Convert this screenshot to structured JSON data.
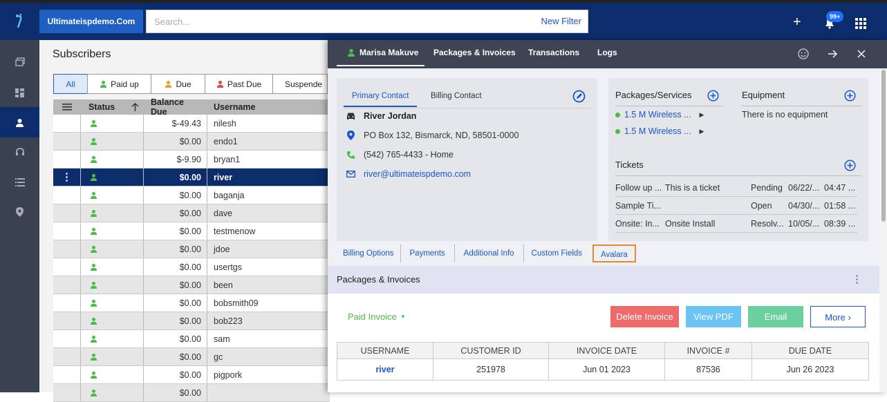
{
  "topbar": {
    "domain": "Ultimateispdemo.Com",
    "search_placeholder": "Search...",
    "new_filter": "New Filter",
    "notif_badge": "99+"
  },
  "sidebar": {
    "icons": [
      "pages-icon",
      "dashboard-icon",
      "user-icon",
      "headset-icon",
      "list-icon",
      "location-icon"
    ],
    "active": 2
  },
  "subscribers": {
    "title": "Subscribers",
    "filters": [
      {
        "label": "All",
        "color": ""
      },
      {
        "label": "Paid up",
        "color": "#4cbb4c"
      },
      {
        "label": "Due",
        "color": "#f0a020"
      },
      {
        "label": "Past Due",
        "color": "#e04848"
      },
      {
        "label": "Suspende",
        "color": "#e04848"
      }
    ],
    "columns": [
      "Status",
      "Balance Due",
      "Username"
    ],
    "rows": [
      {
        "balance": "$-49.43",
        "username": "nilesh"
      },
      {
        "balance": "$0.00",
        "username": "endo1"
      },
      {
        "balance": "$-9.90",
        "username": "bryan1"
      },
      {
        "balance": "$0.00",
        "username": "river"
      },
      {
        "balance": "$0.00",
        "username": "baganja"
      },
      {
        "balance": "$0.00",
        "username": "dave"
      },
      {
        "balance": "$0.00",
        "username": "testmenow"
      },
      {
        "balance": "$0.00",
        "username": "jdoe"
      },
      {
        "balance": "$0.00",
        "username": "usertgs"
      },
      {
        "balance": "$0.00",
        "username": "been"
      },
      {
        "balance": "$0.00",
        "username": "bobsmith09"
      },
      {
        "balance": "$0.00",
        "username": "bob223"
      },
      {
        "balance": "$0.00",
        "username": "sam"
      },
      {
        "balance": "$0.00",
        "username": "gc"
      },
      {
        "balance": "$0.00",
        "username": "pigpork"
      },
      {
        "balance": "$0.00",
        "username": ""
      }
    ]
  },
  "panel": {
    "tabs": [
      "Marisa Makuve",
      "Packages & Invoices",
      "Transactions",
      "Logs"
    ],
    "contact": {
      "tab_primary": "Primary Contact",
      "tab_billing": "Billing Contact",
      "name": "River Jordan",
      "address": "PO Box 132, Bismarck, ND, 58501-0000",
      "phone": "(542) 765-4433 - Home",
      "email": "river@ultimateispdemo.com"
    },
    "packages": {
      "title": "Packages/Services",
      "items": [
        "1.5 M Wireless ...",
        "1.5 M Wireless ..."
      ]
    },
    "equipment": {
      "title": "Equipment",
      "empty": "There is no equipment"
    },
    "tickets": {
      "title": "Tickets",
      "rows": [
        {
          "type": "Follow up ...",
          "subject": "This is a ticket",
          "status": "Pending",
          "date": "06/22/...",
          "time": "04:47 ..."
        },
        {
          "type": "Sample Ti...",
          "subject": "",
          "status": "Open",
          "date": "04/30/...",
          "time": "01:58 ..."
        },
        {
          "type": "Onsite: In...",
          "subject": "Onsite Install",
          "status": "Resolv...",
          "date": "10/05/...",
          "time": "08:39 ..."
        }
      ]
    },
    "bottom_tabs": [
      "Billing Options",
      "Payments",
      "Additional Info",
      "Custom Fields",
      "Avalara"
    ],
    "pi": {
      "title": "Packages & Invoices",
      "status": "Paid Invoice",
      "buttons": {
        "delete": "Delete Invoice",
        "pdf": "View PDF",
        "email": "Email",
        "more": "More"
      },
      "colors": {
        "delete": "#ef6b6b",
        "pdf": "#6cc4f2",
        "email": "#6ccf9e"
      },
      "columns": [
        "USERNAME",
        "CUSTOMER ID",
        "INVOICE DATE",
        "INVOICE #",
        "DUE DATE"
      ],
      "row": [
        "river",
        "251978",
        "Jun 01 2023",
        "87536",
        "Jun 26 2023"
      ]
    }
  }
}
